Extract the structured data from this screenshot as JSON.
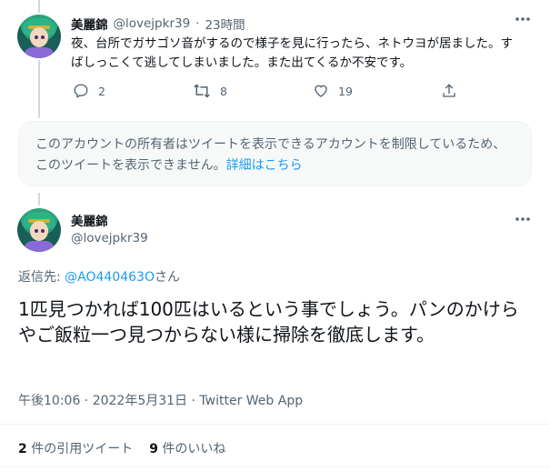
{
  "tweet1": {
    "name": "美麗錦",
    "handle": "@lovejpkr39",
    "time": "23時間",
    "text": "夜、台所でガサゴソ音がするので様子を見に行ったら、ネトウヨが居ました。すばしっこくて逃してしまいました。また出てくるか不安です。",
    "reply_count": "2",
    "retweet_count": "8",
    "like_count": "19"
  },
  "notice": {
    "text": "このアカウントの所有者はツイートを表示できるアカウントを制限しているため、このツイートを表示できません。",
    "link": "詳細はこちら"
  },
  "tweet2": {
    "name": "美麗錦",
    "handle": "@lovejpkr39",
    "reply_label": "返信先:",
    "reply_to": "@AO440463O",
    "reply_suffix": "さん",
    "text": "1匹見つかれば100匹はいるという事でしょう。パンのかけらやご飯粒一つ見つからない様に掃除を徹底します。",
    "timestamp": "午後10:06 · 2022年5月31日 · Twitter Web App",
    "quote_count": "2",
    "quote_label": "件の引用ツイート",
    "like_count": "9",
    "like_label": "件のいいね"
  },
  "colors": {
    "accent": "#1d9bf0",
    "muted": "#536471",
    "border": "#eff3f4"
  },
  "icons": [
    "more-icon",
    "reply-icon",
    "retweet-icon",
    "like-icon",
    "share-icon"
  ]
}
